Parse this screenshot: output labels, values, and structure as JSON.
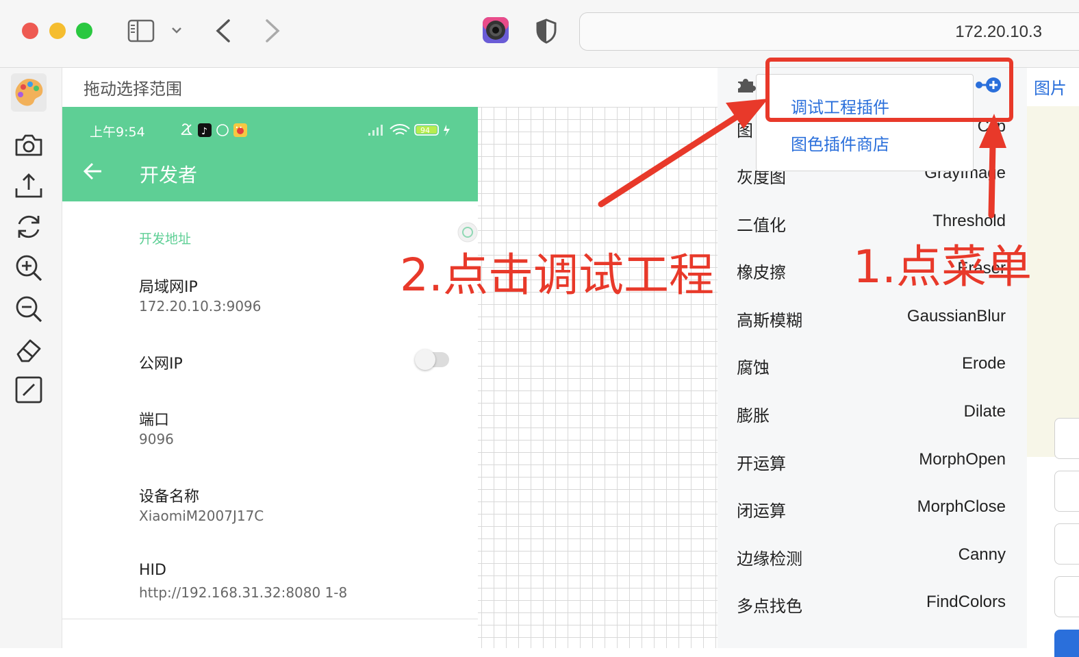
{
  "browser": {
    "address": "172.20.10.3",
    "traffic_lights": [
      "#ee5a52",
      "#f5bd2f",
      "#2ac840"
    ]
  },
  "toolbar": {
    "hint": "拖动选择范围",
    "tools": [
      "palette-icon",
      "camera-icon",
      "upload-icon",
      "refresh-icon",
      "zoom-in-icon",
      "zoom-out-icon",
      "eraser-icon",
      "crop-icon"
    ]
  },
  "phone": {
    "status_time": "上午9:54",
    "battery": "94",
    "title": "开发者",
    "section": "开发地址",
    "rows": [
      {
        "label": "局域网IP",
        "value": "172.20.10.3:9096"
      },
      {
        "label": "公网IP",
        "value": ""
      },
      {
        "label": "端口",
        "value": "9096"
      },
      {
        "label": "设备名称",
        "value": "XiaomiM2007J17C"
      },
      {
        "label": "HID",
        "value": "http://192.168.31.32:8080 1-8"
      }
    ]
  },
  "dropdown": {
    "items": [
      "调试工程插件",
      "图色插件商店"
    ]
  },
  "menu": [
    {
      "cn": "图",
      "en": "Clip"
    },
    {
      "cn": "灰度图",
      "en": "GrayImage"
    },
    {
      "cn": "二值化",
      "en": "Threshold"
    },
    {
      "cn": "橡皮擦",
      "en": "Eraser"
    },
    {
      "cn": "高斯模糊",
      "en": "GaussianBlur"
    },
    {
      "cn": "腐蚀",
      "en": "Erode"
    },
    {
      "cn": "膨胀",
      "en": "Dilate"
    },
    {
      "cn": "开运算",
      "en": "MorphOpen"
    },
    {
      "cn": "闭运算",
      "en": "MorphClose"
    },
    {
      "cn": "边缘检测",
      "en": "Canny"
    },
    {
      "cn": "多点找色",
      "en": "FindColors"
    }
  ],
  "right_tab": "图片",
  "annotations": {
    "step1": "1.点菜单",
    "step2": "2.点击调试工程"
  },
  "colors": {
    "annotation": "#e8392a",
    "phone_header": "#5ecf95",
    "link": "#2a6fdb"
  }
}
